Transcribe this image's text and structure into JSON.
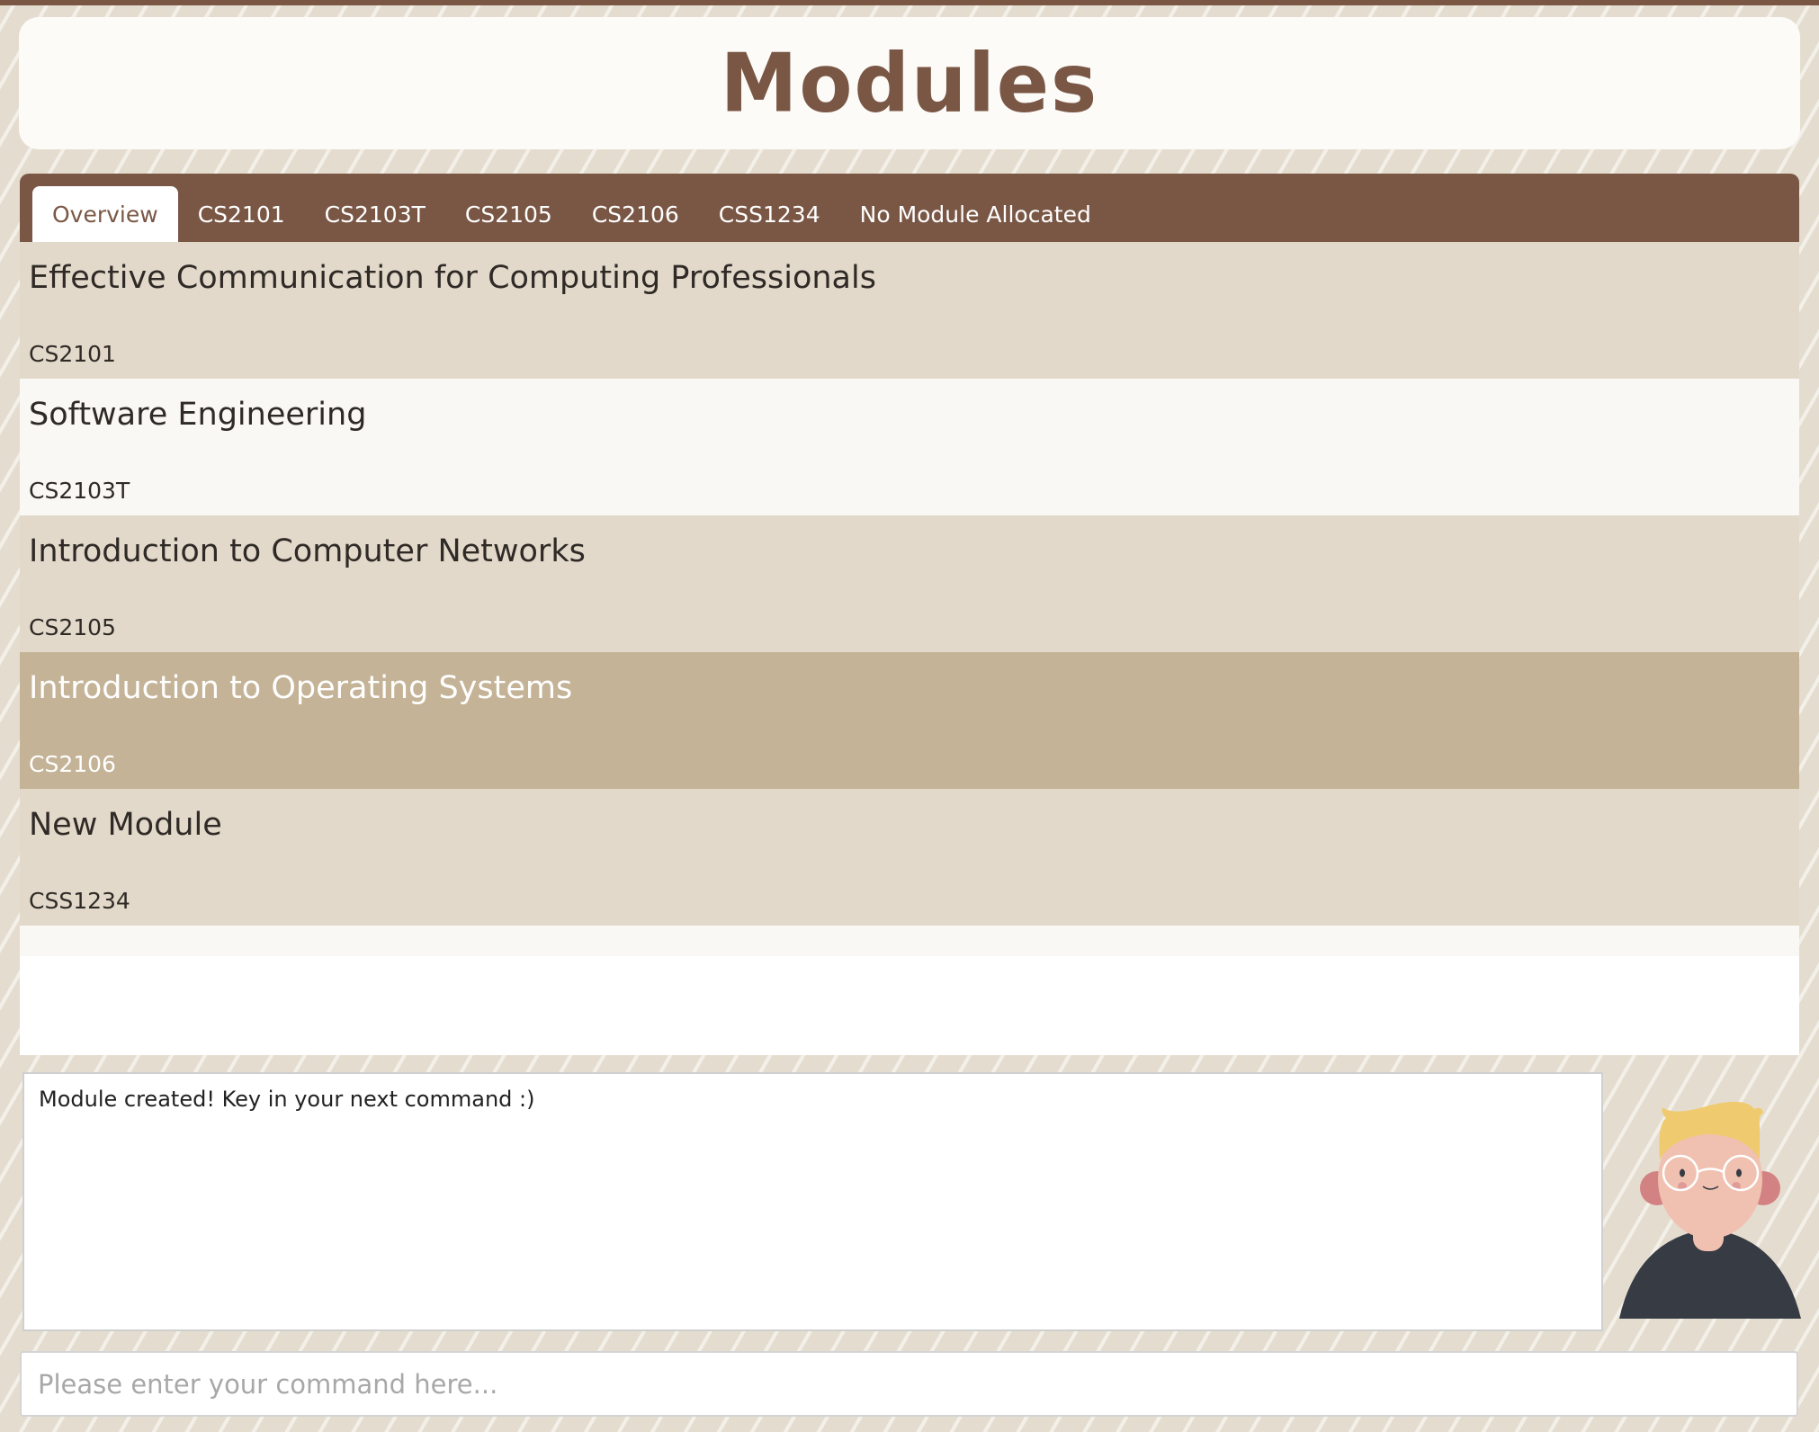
{
  "header": {
    "title": "Modules"
  },
  "tabs": [
    {
      "label": "Overview",
      "active": true
    },
    {
      "label": "CS2101"
    },
    {
      "label": "CS2103T"
    },
    {
      "label": "CS2105"
    },
    {
      "label": "CS2106"
    },
    {
      "label": "CSS1234"
    },
    {
      "label": "No Module Allocated"
    }
  ],
  "modules": [
    {
      "name": "Effective Communication for Computing Professionals",
      "code": "CS2101"
    },
    {
      "name": "Software Engineering",
      "code": "CS2103T"
    },
    {
      "name": "Introduction to Computer Networks",
      "code": "CS2105"
    },
    {
      "name": "Introduction to Operating Systems",
      "code": "CS2106",
      "selected": true
    },
    {
      "name": "New Module",
      "code": "CSS1234"
    }
  ],
  "result": {
    "text": "Module created! Key in your next command :)"
  },
  "command": {
    "placeholder": "Please enter your command here...",
    "value": ""
  },
  "colors": {
    "brand": "#7a5745",
    "selected_row": "#c4b396",
    "row_alt": "#e2d9ca"
  }
}
